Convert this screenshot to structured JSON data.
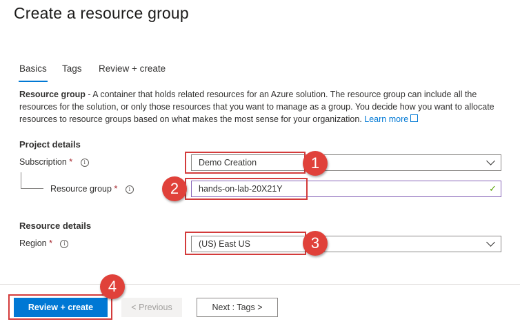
{
  "page": {
    "title": "Create a resource group"
  },
  "tabs": [
    {
      "label": "Basics"
    },
    {
      "label": "Tags"
    },
    {
      "label": "Review + create"
    }
  ],
  "description": {
    "term": "Resource group",
    "text": " - A container that holds related resources for an Azure solution. The resource group can include all the resources for the solution, or only those resources that you want to manage as a group. You decide how you want to allocate resources to resource groups based on what makes the most sense for your organization. ",
    "link": "Learn more"
  },
  "project_details": {
    "heading": "Project details",
    "subscription": {
      "label": "Subscription",
      "required": "*",
      "value": "Demo Creation"
    },
    "resource_group": {
      "label": "Resource group",
      "required": "*",
      "value": "hands-on-lab-20X21Y"
    }
  },
  "resource_details": {
    "heading": "Resource details",
    "region": {
      "label": "Region",
      "required": "*",
      "value": "(US) East US"
    }
  },
  "footer": {
    "review_create": "Review + create",
    "previous": "< Previous",
    "next": "Next : Tags >"
  },
  "annotations": {
    "steps": [
      "1",
      "2",
      "3",
      "4"
    ]
  },
  "colors": {
    "accent": "#0078d4",
    "annotation": "#e0413a",
    "required": "#a4262c",
    "valid": "#57a300"
  }
}
